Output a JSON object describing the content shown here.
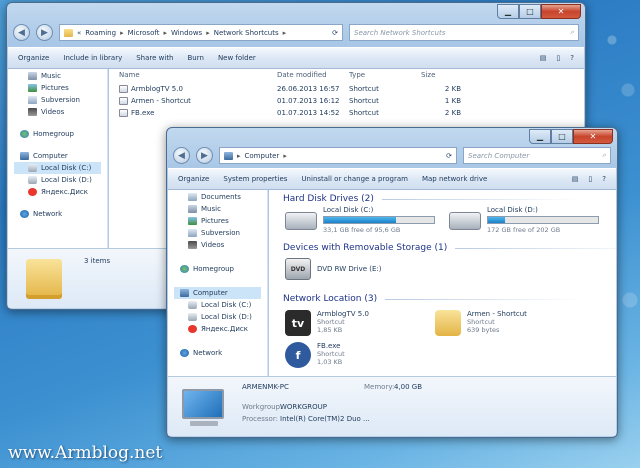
{
  "back_window": {
    "address": {
      "parts": [
        "«",
        "Roaming",
        "Microsoft",
        "Windows",
        "Network Shortcuts"
      ]
    },
    "search": {
      "placeholder": "Search Network Shortcuts"
    },
    "toolbar": {
      "organize": "Organize",
      "include_in_library": "Include in library",
      "share_with": "Share with",
      "burn": "Burn",
      "new_folder": "New folder"
    },
    "nav": [
      {
        "label": "Music",
        "icon": "music-icon"
      },
      {
        "label": "Pictures",
        "icon": "pictures-icon"
      },
      {
        "label": "Subversion",
        "icon": "folder-icon"
      },
      {
        "label": "Videos",
        "icon": "videos-icon"
      },
      {
        "label": "Homegroup",
        "icon": "homegroup-icon"
      },
      {
        "label": "Computer",
        "icon": "computer-icon"
      },
      {
        "label": "Local Disk (C:)",
        "icon": "drive-icon"
      },
      {
        "label": "Local Disk (D:)",
        "icon": "drive-icon"
      },
      {
        "label": "Яндекс.Диск",
        "icon": "yandex-disk-icon"
      },
      {
        "label": "Network",
        "icon": "network-icon"
      }
    ],
    "columns": {
      "name": "Name",
      "date_modified": "Date modified",
      "type": "Type",
      "size": "Size"
    },
    "files": [
      {
        "name": "ArmblogTV 5.0",
        "date": "26.06.2013 16:57",
        "type": "Shortcut",
        "size": "2 KB"
      },
      {
        "name": "Armen - Shortcut",
        "date": "01.07.2013 16:12",
        "type": "Shortcut",
        "size": "1 KB"
      },
      {
        "name": "FB.exe",
        "date": "01.07.2013 14:52",
        "type": "Shortcut",
        "size": "2 KB"
      }
    ],
    "status": "3 items"
  },
  "front_window": {
    "address": {
      "parts": [
        "Computer"
      ]
    },
    "search": {
      "placeholder": "Search Computer"
    },
    "toolbar": {
      "organize": "Organize",
      "system_properties": "System properties",
      "uninstall": "Uninstall or change a program",
      "map_network_drive": "Map network drive"
    },
    "nav": [
      {
        "label": "Documents",
        "icon": "documents-icon"
      },
      {
        "label": "Music",
        "icon": "music-icon"
      },
      {
        "label": "Pictures",
        "icon": "pictures-icon"
      },
      {
        "label": "Subversion",
        "icon": "folder-icon"
      },
      {
        "label": "Videos",
        "icon": "videos-icon"
      },
      {
        "label": "Homegroup",
        "icon": "homegroup-icon"
      },
      {
        "label": "Computer",
        "icon": "computer-icon"
      },
      {
        "label": "Local Disk (C:)",
        "icon": "drive-icon"
      },
      {
        "label": "Local Disk (D:)",
        "icon": "drive-icon"
      },
      {
        "label": "Яндекс.Диск",
        "icon": "yandex-disk-icon"
      },
      {
        "label": "Network",
        "icon": "network-icon"
      }
    ],
    "groups": {
      "hdd": "Hard Disk Drives (2)",
      "removable": "Devices with Removable Storage (1)",
      "network": "Network Location (3)"
    },
    "drives": [
      {
        "name": "Local Disk (C:)",
        "free": "33,1 GB free of 95,6 GB",
        "used_fraction": 0.65
      },
      {
        "name": "Local Disk (D:)",
        "free": "172 GB free of 202 GB",
        "used_fraction": 0.15
      }
    ],
    "removable": {
      "name": "DVD RW Drive (E:)"
    },
    "network_items": [
      {
        "name": "ArmblogTV 5.0",
        "type": "Shortcut",
        "size": "1,85 KB"
      },
      {
        "name": "Armen - Shortcut",
        "type": "Shortcut",
        "size": "639 bytes"
      },
      {
        "name": "FB.exe",
        "type": "Shortcut",
        "size": "1,03 KB"
      }
    ],
    "details": {
      "pc_name": "ARMENMK-PC",
      "workgroup_label": "Workgroup:",
      "workgroup": "WORKGROUP",
      "memory_label": "Memory:",
      "memory": "4,00 GB",
      "processor_label": "Processor:",
      "processor": "Intel(R) Core(TM)2 Duo ..."
    }
  },
  "watermark": "www.Armblog.net"
}
